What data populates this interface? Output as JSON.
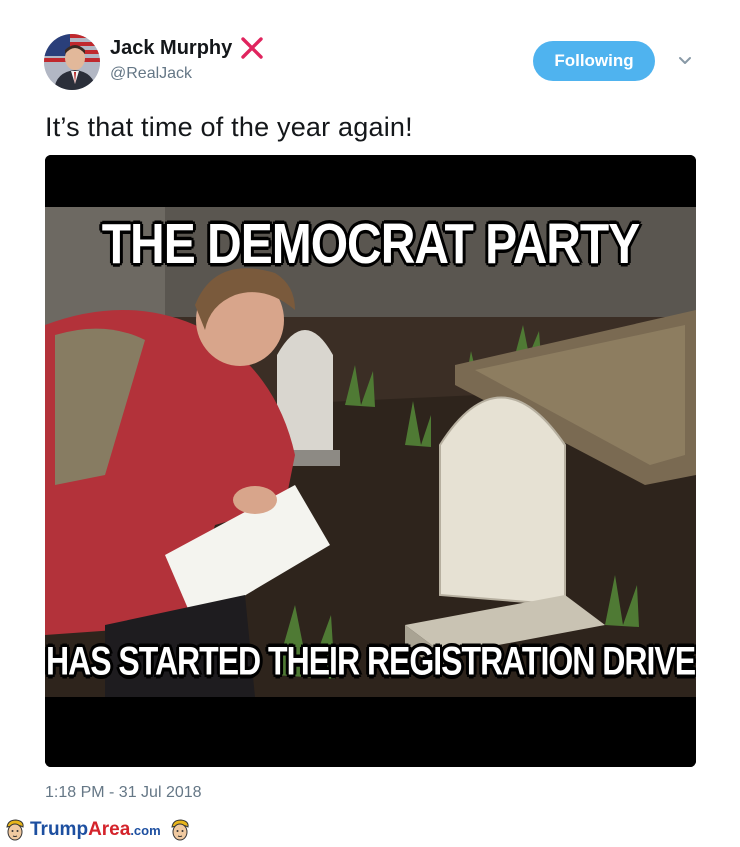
{
  "tweet": {
    "author_name": "Jack Murphy",
    "author_handle": "@RealJack",
    "follow_label": "Following",
    "text": "It’s that time of the year again!",
    "timestamp": "1:18 PM - 31 Jul 2018"
  },
  "meme": {
    "top_caption": "THE DEMOCRAT PARTY",
    "bottom_caption": "HAS STARTED THEIR REGISTRATION DRIVE"
  },
  "footer": {
    "logo_trump": "Trump",
    "logo_area": "Area",
    "logo_com": ".com"
  },
  "colors": {
    "follow_button": "#4fb3ef",
    "x_mark": "#e0245e",
    "logo_blue": "#1d4fa0",
    "logo_red": "#d4232b"
  },
  "icons": {
    "verified_mark": "red-x-icon",
    "menu": "chevron-down-icon",
    "footer_mascot": "trump-face-icon"
  }
}
